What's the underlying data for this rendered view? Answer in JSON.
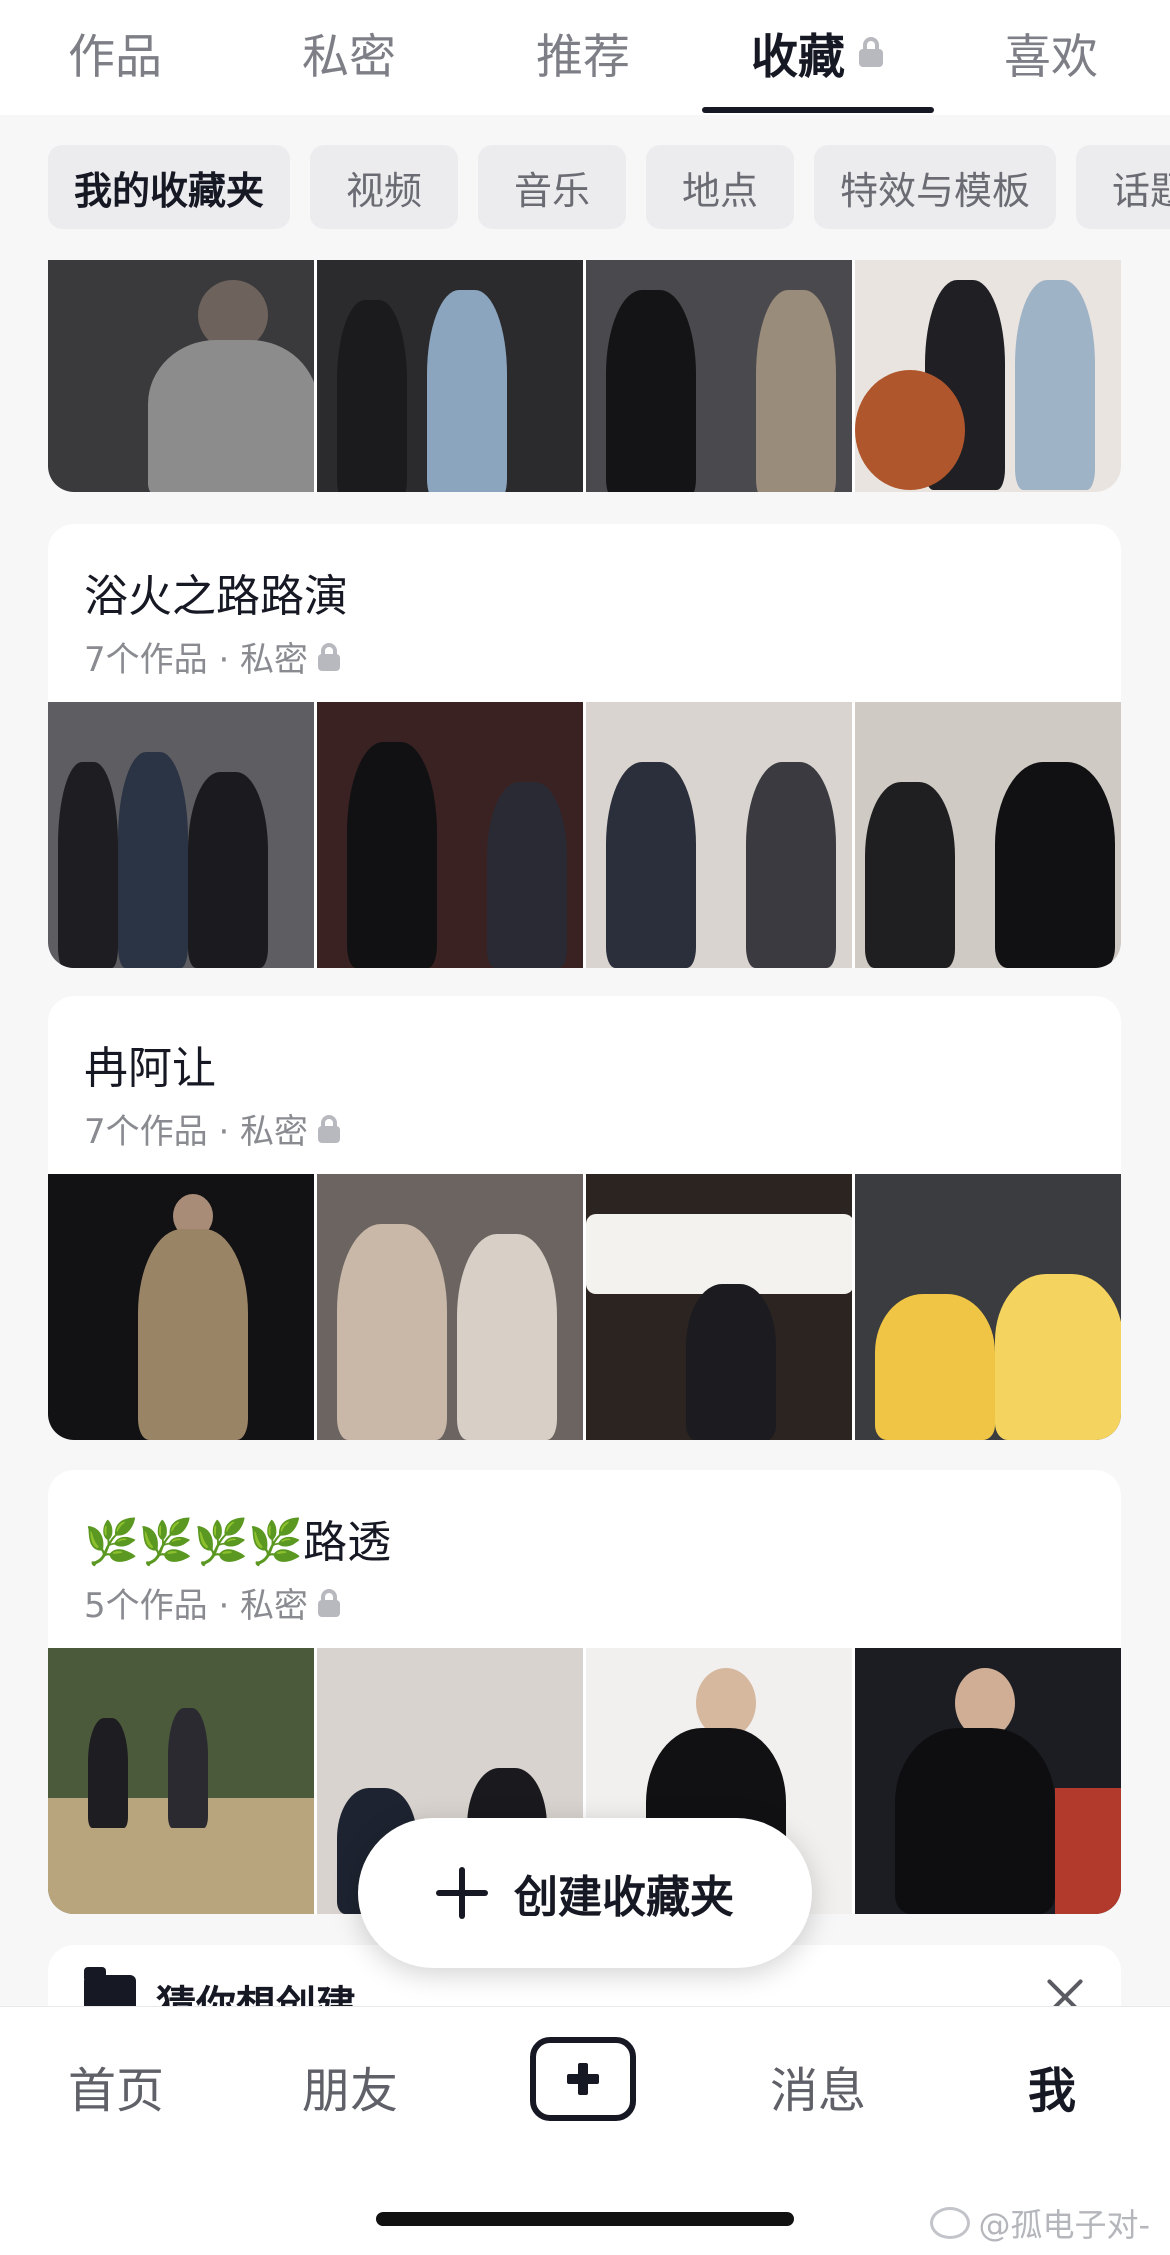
{
  "top_tabs": {
    "items": [
      {
        "label": "作品"
      },
      {
        "label": "私密"
      },
      {
        "label": "推荐"
      },
      {
        "label": "收藏"
      },
      {
        "label": "喜欢"
      }
    ],
    "active": "收藏"
  },
  "filter_chips": {
    "items": [
      {
        "label": "我的收藏夹"
      },
      {
        "label": "视频"
      },
      {
        "label": "音乐"
      },
      {
        "label": "地点"
      },
      {
        "label": "特效与模板"
      },
      {
        "label": "话题"
      }
    ],
    "active": "我的收藏夹"
  },
  "collections": [
    {
      "title": "浴火之路路演",
      "meta": "7个作品 · 私密"
    },
    {
      "title": "冉阿让",
      "meta": "7个作品 · 私密"
    },
    {
      "title": "🌿🌿🌿🌿路透",
      "meta": "5个作品 · 私密"
    }
  ],
  "create_button": {
    "label": "创建收藏夹"
  },
  "suggest": {
    "label": "猜你想创建"
  },
  "bottom_nav": {
    "items": [
      {
        "label": "首页"
      },
      {
        "label": "朋友"
      },
      {
        "label": "消息"
      },
      {
        "label": "我"
      }
    ],
    "active": "我"
  },
  "watermark": {
    "text": "@孤电子对-"
  },
  "colors": {
    "text_primary": "#161823",
    "text_secondary": "#8a8b91",
    "chip_bg": "#ececef",
    "page_bg": "#f7f7f8"
  }
}
